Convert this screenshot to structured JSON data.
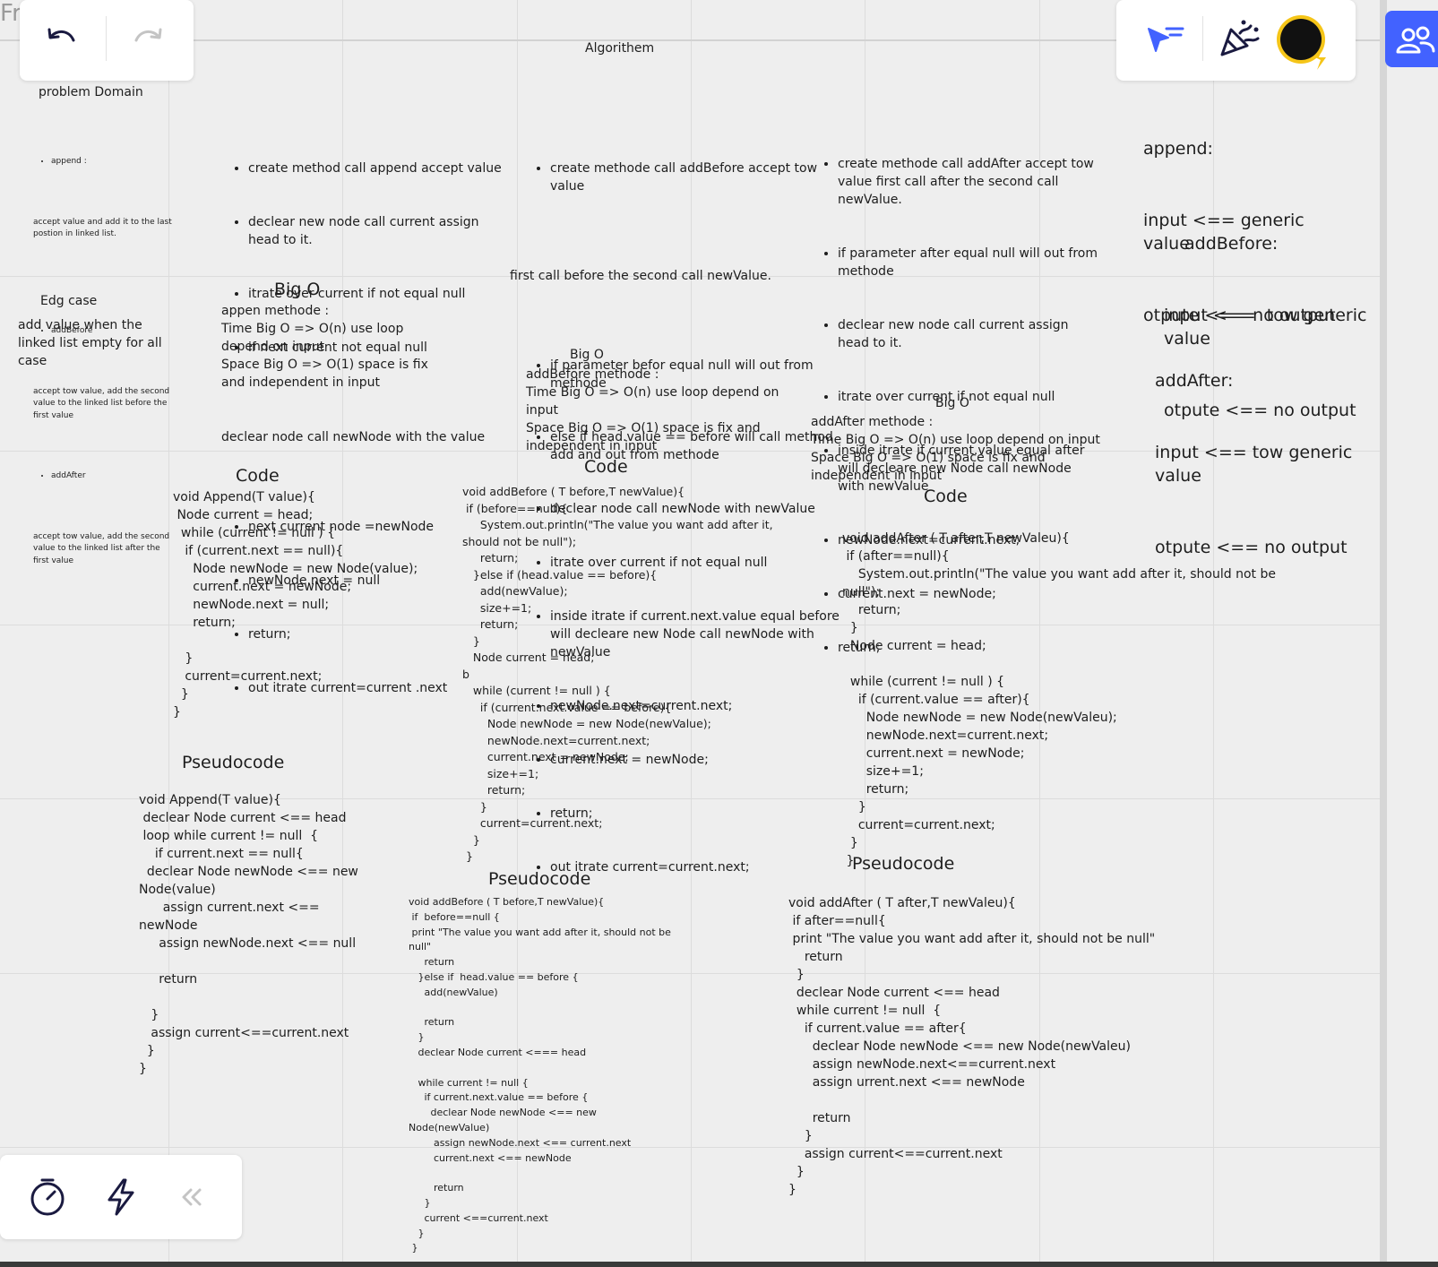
{
  "frame": {
    "label": "Fr"
  },
  "title": "Algorithem",
  "problem_domain": {
    "title": "problem Domain",
    "items": [
      {
        "name": "append :",
        "desc": "accept value and add it to the last postion in linked list."
      },
      {
        "name": "addBefore",
        "desc": "accept tow value, add the second value to the linked list before the first value"
      },
      {
        "name": "addAfter",
        "desc": "accept tow value, add the second value to the linked list after the first value"
      }
    ]
  },
  "edge_case": {
    "title": "Edg case",
    "text": "add value when the linked list empty for all case"
  },
  "append_steps": {
    "list1": [
      "create method call append accept value",
      "declear new node call current assign head to it.",
      "itrate over current if not equal null",
      "if next current not equal null"
    ],
    "line": "declear node call newNode with the value",
    "list2": [
      "next current node =newNode",
      "newNode.next = null",
      "return;",
      "out itrate current=current .next"
    ]
  },
  "before_steps": {
    "first": "create methode call addBefore accept tow value",
    "line": "first call before the second call newValue.",
    "list": [
      "if parameter befor equal null will out from methode",
      "else if head.value == before will call method add and out from methode",
      "declear node call newNode with newValue",
      "itrate over current if not equal null",
      "inside itrate if current.next.value equal before will decleare new Node call newNode with newValue",
      "newNode.next=current.next;",
      "current.next = newNode;",
      "return;",
      "out itrate current=current.next;"
    ]
  },
  "after_steps": {
    "list": [
      "create methode call addAfter accept tow value first call after the second call newValue.",
      "if parameter after equal null will out from methode",
      "declear new node call current assign head to it.",
      "itrate over current if not equal null",
      "inside itrate if current.value equal after will decleare new Node call newNode with newValue",
      "newNode.next=current.next;",
      "current.next = newNode;",
      "return;"
    ]
  },
  "bigo_append": {
    "title": "Big O",
    "text": "appen methode :\nTime Big O => O(n) use loop depend on input\nSpace Big O => O(1) space is fix and independent in input"
  },
  "bigo_before": {
    "title": "Big O",
    "text": "addBefore methode :\nTime Big O => O(n) use loop depend on input\nSpace Big O => O(1) space is fix and independent in input"
  },
  "bigo_after": {
    "title": "Big O",
    "text": "addAfter methode :\nTime Big O => O(n) use loop depend on input\nSpace Big O => O(1) space is fix and independent in input"
  },
  "signatures": {
    "append": {
      "name": "append:",
      "input": "input <== generic value",
      "output": "otpute <== no output"
    },
    "before": {
      "name": "addBefore:",
      "input": "input <==  tow generic value",
      "output": "otpute <== no output"
    },
    "after": {
      "name": "addAfter:",
      "input": "input <== tow generic value",
      "output": "otpute <== no output"
    }
  },
  "code_append": {
    "title": "Code",
    "text": "void Append(T value){\n Node current = head;\n  while (current != null ) {\n   if (current.next == null){\n     Node newNode = new Node(value);\n     current.next = newNode;\n     newNode.next = null;\n     return;\n\n   }\n   current=current.next;\n  }\n}"
  },
  "code_before": {
    "title": "Code",
    "text": "void addBefore ( T before,T newValue){\n if (before==null){\n     System.out.println(\"The value you want add after it, should not be null\");\n     return;\n   }else if (head.value == before){\n     add(newValue);\n     size+=1;\n     return;\n   }\n   Node current = head;\nb\n   while (current != null ) {\n     if (current.next.value == before){\n       Node newNode = new Node(newValue);\n       newNode.next=current.next;\n       current.next = newNode;\n       size+=1;\n       return;\n     }\n     current=current.next;\n   }\n }"
  },
  "code_after": {
    "title": "Code",
    "text": "void addAfter ( T after,T newValeu){\n if (after==null){\n    System.out.println(\"The value you want add after it, should not be null\");\n    return;\n  }\n  Node current = head;\n\n  while (current != null ) {\n    if (current.value == after){\n      Node newNode = new Node(newValeu);\n      newNode.next=current.next;\n      current.next = newNode;\n      size+=1;\n      return;\n    }\n    current=current.next;\n  }\n }"
  },
  "pseudo_append": {
    "title": "Pseudocode",
    "text": "void Append(T value){\n declear Node current <== head\n loop while current != null  {\n    if current.next == null{\n  declear Node newNode <== new Node(value)\n      assign current.next <== newNode\n     assign newNode.next <== null\n\n     return\n\n   }\n   assign current<==current.next\n  }\n}"
  },
  "pseudo_before": {
    "title": "Pseudocode",
    "text": "void addBefore ( T before,T newValue){\n if  before==null {\n print \"The value you want add after it, should not be null\"\n     return\n   }else if  head.value == before {\n     add(newValue)\n\n     return\n   }\n   declear Node current <=== head\n\n   while current != null {\n     if current.next.value == before {\n       declear Node newNode <== new Node(newValue)\n        assign newNode.next <== current.next\n        current.next <== newNode\n\n        return\n     }\n     current <==current.next\n   }\n }"
  },
  "pseudo_after": {
    "title": "Pseudocode",
    "text": "void addAfter ( T after,T newValeu){\n if after==null{\n print \"The value you want add after it, should not be null\"\n    return\n  }\n  declear Node current <== head\n  while current != null  {\n    if current.value == after{\n      declear Node newNode <== new Node(newValeu)\n      assign newNode.next<==current.next\n      assign urrent.next <== newNode\n\n      return\n    }\n    assign current<==current.next\n  }\n}"
  },
  "toolbar": {
    "undo_icon": "undo-icon",
    "redo_icon": "redo-icon",
    "cursor_icon": "cursor-icon",
    "celebrate_icon": "party-popper-icon",
    "avatar_color": "#111111",
    "avatar_ring": "#f5c518",
    "collab_icon": "users-icon",
    "accent": "#4262ff"
  },
  "bottom_toolbar": {
    "timer_icon": "timer-icon",
    "lightning_icon": "lightning-icon",
    "collapse_icon": "double-chevron-left-icon"
  }
}
